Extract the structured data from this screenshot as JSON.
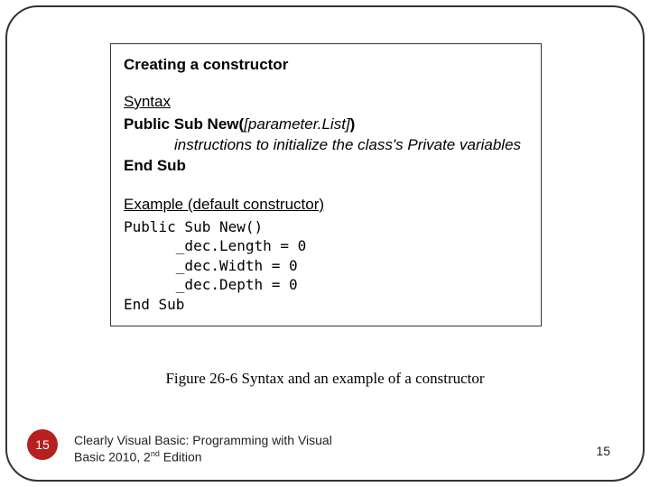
{
  "box": {
    "title": "Creating a constructor",
    "syntax_label": "Syntax",
    "sig_prefix": "Public Sub New(",
    "sig_param": "[parameter.List]",
    "sig_suffix": ")",
    "instructions": "instructions to initialize the class's Private variables",
    "end_sub": "End Sub",
    "example_label": "Example (default constructor)",
    "code_line1": "Public Sub New()",
    "code_line2": "      _dec.Length = 0",
    "code_line3": "      _dec.Width = 0",
    "code_line4": "      _dec.Depth = 0",
    "code_line5": "End Sub"
  },
  "caption": "Figure 26-6 Syntax and an example of a constructor",
  "badge": "15",
  "footer_line1": "Clearly Visual Basic: Programming with Visual",
  "footer_line2a": "Basic 2010, 2",
  "footer_line2b": "nd",
  "footer_line2c": " Edition",
  "page_num": "15"
}
